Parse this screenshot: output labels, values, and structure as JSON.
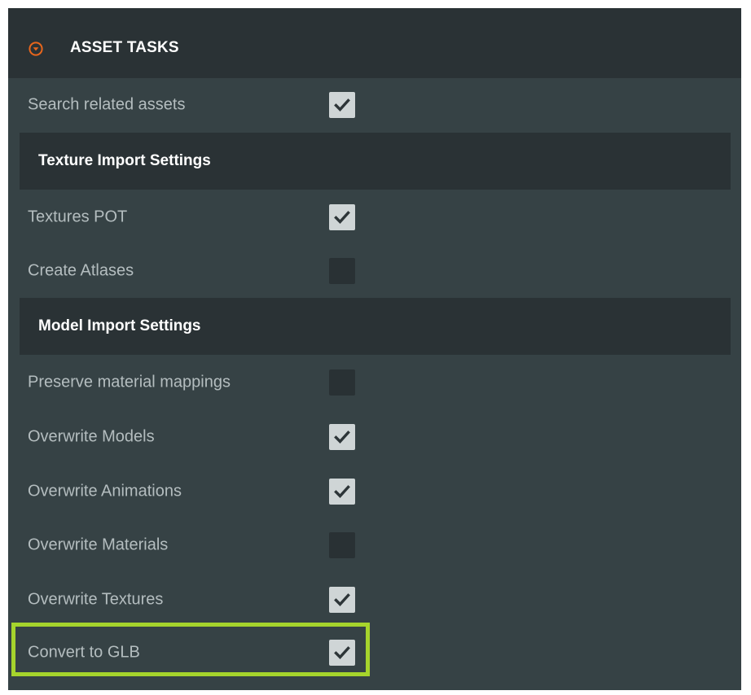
{
  "header": {
    "title": "ASSET TASKS",
    "icon": "collapse-circle-icon",
    "accent_color": "#e8661c"
  },
  "rows": [
    {
      "label": "Search related assets",
      "checked": true
    },
    {
      "label": "Textures POT",
      "checked": true
    },
    {
      "label": "Create Atlases",
      "checked": false
    },
    {
      "label": "Preserve material mappings",
      "checked": false
    },
    {
      "label": "Overwrite Models",
      "checked": true
    },
    {
      "label": "Overwrite Animations",
      "checked": true
    },
    {
      "label": "Overwrite Materials",
      "checked": false
    },
    {
      "label": "Overwrite Textures",
      "checked": true
    },
    {
      "label": "Convert to GLB",
      "checked": true
    }
  ],
  "sections": {
    "texture": "Texture Import Settings",
    "model": "Model Import Settings"
  },
  "highlight_color": "#a6d42c"
}
